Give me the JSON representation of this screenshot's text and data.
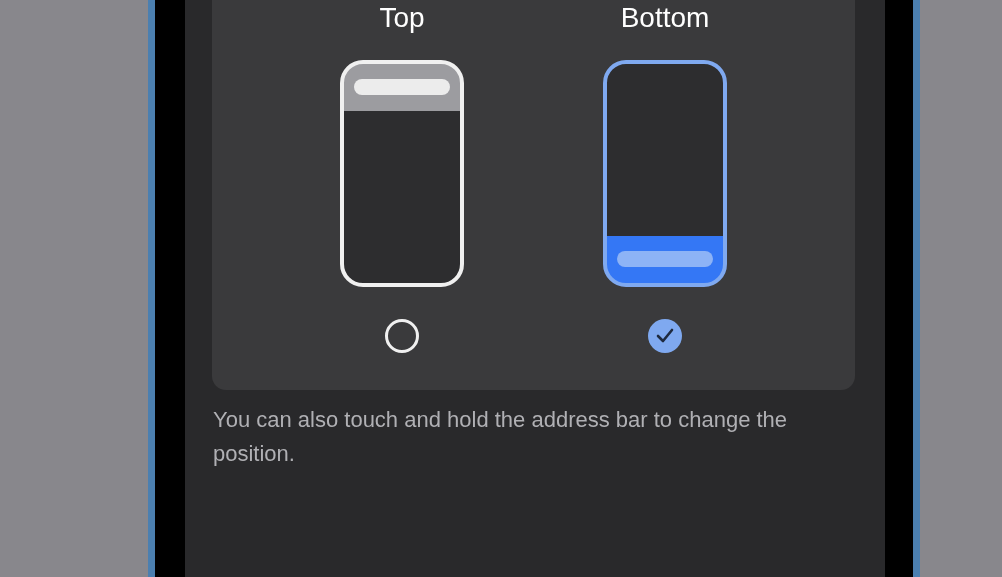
{
  "options": [
    {
      "label": "Top",
      "kind": "top",
      "selected": false
    },
    {
      "label": "Bottom",
      "kind": "bottom",
      "selected": true
    }
  ],
  "footer": "You can also touch and hold the address bar to change the position."
}
